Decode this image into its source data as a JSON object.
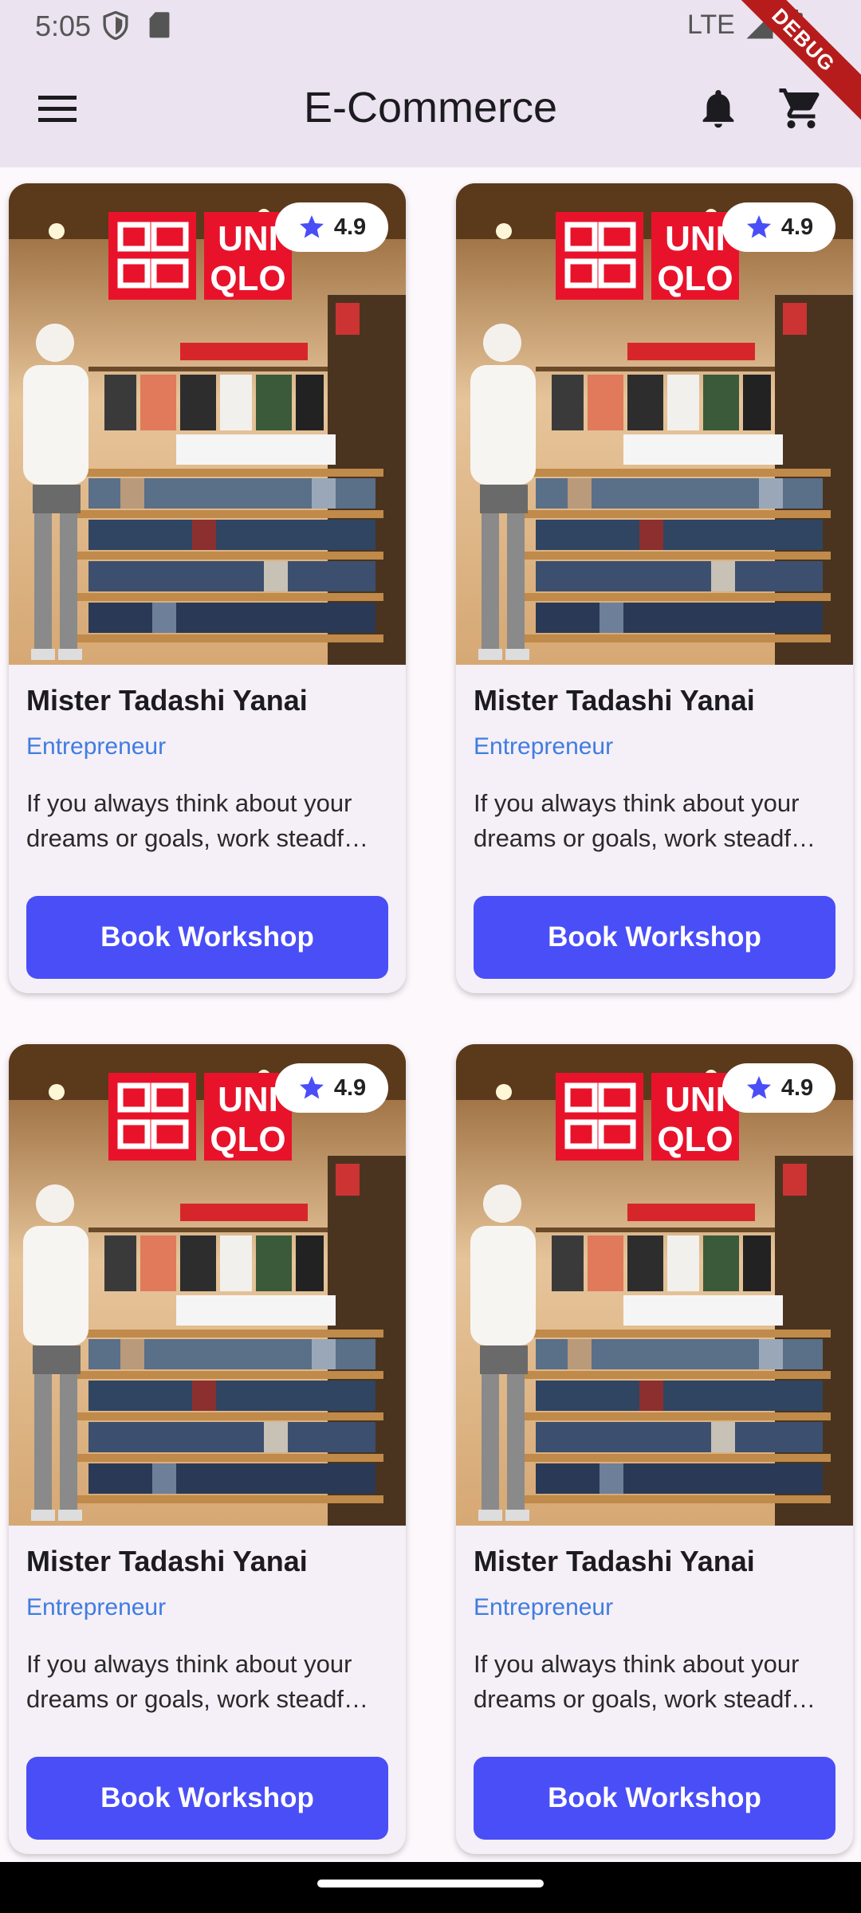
{
  "status_bar": {
    "time": "5:05",
    "network": "LTE",
    "icons": [
      "shield-icon",
      "sd-card-icon",
      "signal-icon",
      "battery-icon"
    ]
  },
  "debug_banner": "DEBUG",
  "app_bar": {
    "title": "E-Commerce",
    "icons": [
      "menu-icon",
      "bell-icon",
      "cart-icon"
    ]
  },
  "colors": {
    "primary_button": "#4a4ef7",
    "role_text": "#3f7de0",
    "star": "#4a4ef7",
    "app_bar_bg": "#ebe3f0"
  },
  "cards": [
    {
      "rating": "4.9",
      "name": "Mister Tadashi Yanai",
      "role": "Entrepreneur",
      "desc_line1": "If you always think about your",
      "desc_line2": "dreams or goals, work steadf…",
      "button": "Book Workshop",
      "logo_text_top": "UNI",
      "logo_text_bottom": "QLO"
    },
    {
      "rating": "4.9",
      "name": "Mister Tadashi Yanai",
      "role": "Entrepreneur",
      "desc_line1": "If you always think about your",
      "desc_line2": "dreams or goals, work steadf…",
      "button": "Book Workshop",
      "logo_text_top": "UNI",
      "logo_text_bottom": "QLO"
    },
    {
      "rating": "4.9",
      "name": "Mister Tadashi Yanai",
      "role": "Entrepreneur",
      "desc_line1": "If you always think about your",
      "desc_line2": "dreams or goals, work steadf…",
      "button": "Book Workshop",
      "logo_text_top": "UNI",
      "logo_text_bottom": "QLO"
    },
    {
      "rating": "4.9",
      "name": "Mister Tadashi Yanai",
      "role": "Entrepreneur",
      "desc_line1": "If you always think about your",
      "desc_line2": "dreams or goals, work steadf…",
      "button": "Book Workshop",
      "logo_text_top": "UNI",
      "logo_text_bottom": "QLO"
    }
  ]
}
